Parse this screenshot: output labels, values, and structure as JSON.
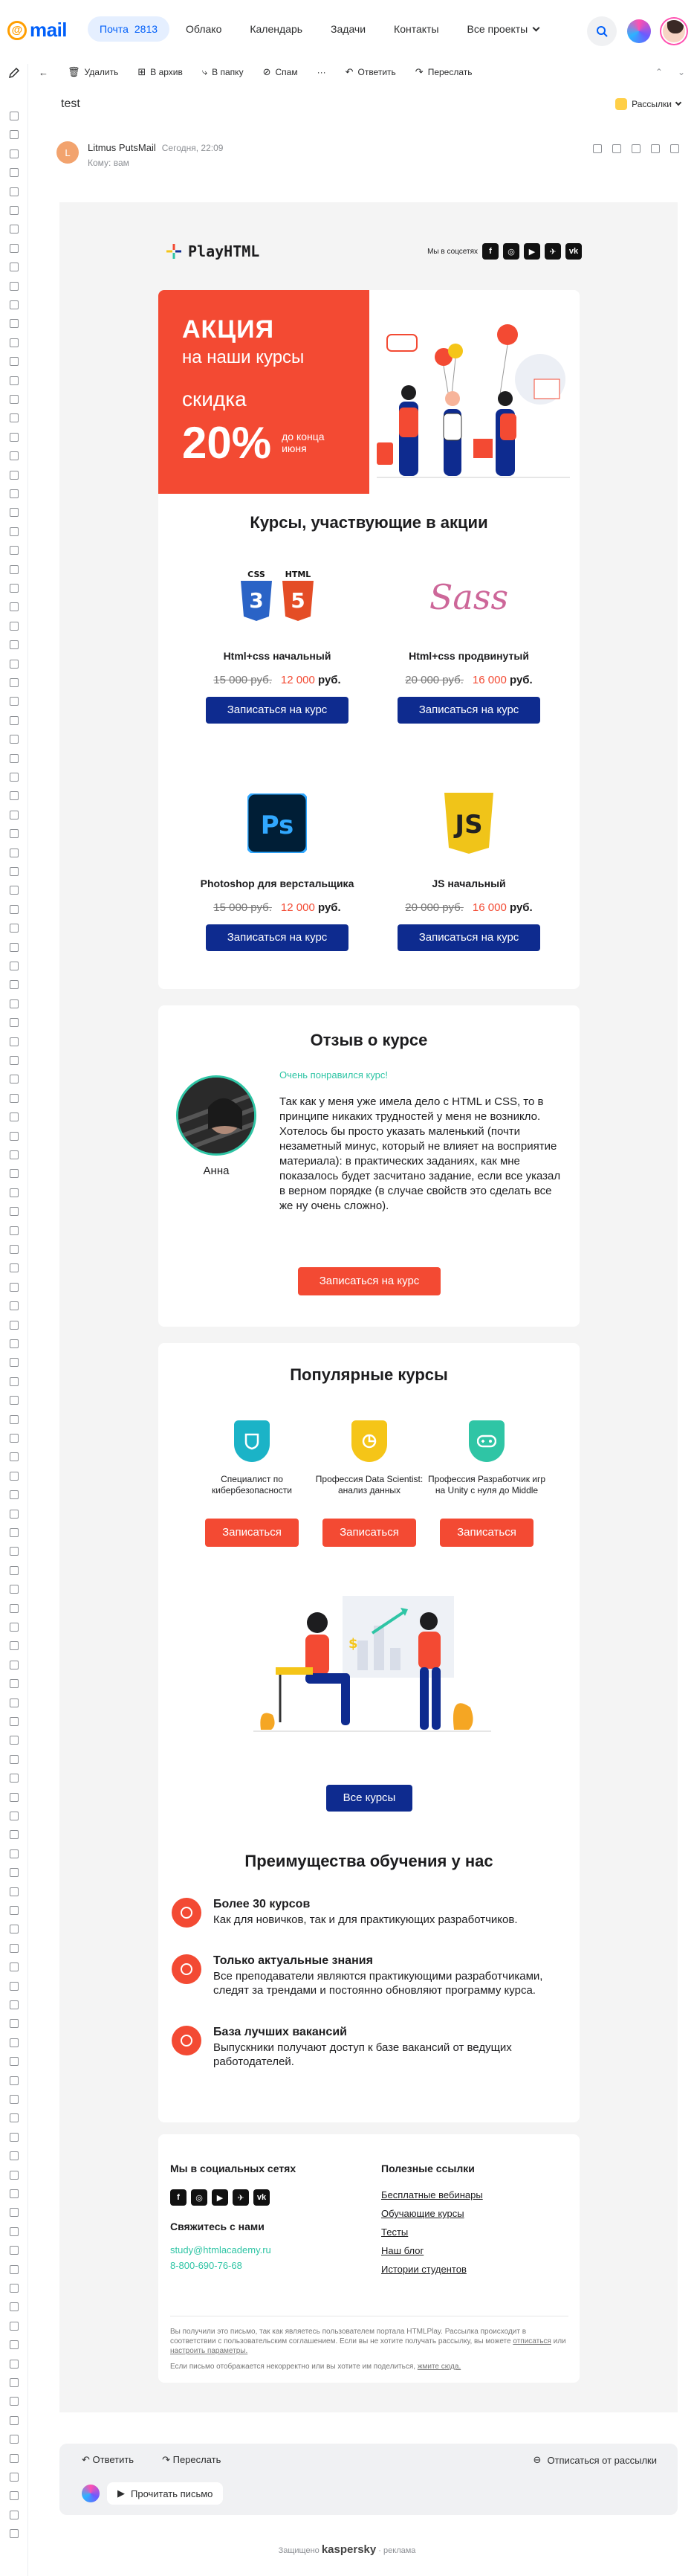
{
  "topbar": {
    "logo_text": "mail",
    "nav": [
      {
        "label": "Почта",
        "count": "2813"
      },
      {
        "label": "Облако"
      },
      {
        "label": "Календарь"
      },
      {
        "label": "Задачи"
      },
      {
        "label": "Контакты"
      },
      {
        "label": "Все проекты"
      }
    ]
  },
  "toolbar": {
    "delete": "Удалить",
    "archive": "В архив",
    "to_folder": "В папку",
    "spam": "Спам",
    "more": "···",
    "reply": "Ответить",
    "forward": "Переслать"
  },
  "message": {
    "subject": "test",
    "category": "Рассылки",
    "sender_initial": "L",
    "sender_name": "Litmus PutsMail",
    "date": "Сегодня, 22:09",
    "to": "Кому: вам"
  },
  "email": {
    "brand": "PlayHTML",
    "social_label": "Мы в соцсетях",
    "social_icons": [
      "f",
      "◎",
      "▶",
      "✈",
      "vk"
    ],
    "promo": {
      "line1": "АКЦИЯ",
      "line2": "на наши курсы",
      "line3": "скидка",
      "percent": "20%",
      "until": "до конца июня"
    },
    "courses_title": "Курсы, участвующие в акции",
    "courses": [
      {
        "name": "Html+css начальный",
        "old": "15 000 руб.",
        "new": "12 000",
        "rub": "руб.",
        "button": "Записаться на курс"
      },
      {
        "name": "Html+css продвинутый",
        "old": "20 000 руб.",
        "new": "16 000",
        "rub": "руб.",
        "button": "Записаться на курс"
      },
      {
        "name": "Photoshop для верстальщика",
        "old": "15 000 руб.",
        "new": "12 000",
        "rub": "руб.",
        "button": "Записаться на курс"
      },
      {
        "name": "JS начальный",
        "old": "20 000 руб.",
        "new": "16 000",
        "rub": "руб.",
        "button": "Записаться на курс"
      }
    ],
    "course_icons": [
      "CSS",
      "HTML",
      "Sass",
      "Ps",
      "JS"
    ],
    "review": {
      "title": "Отзыв о курсе",
      "headline": "Очень понравился курс!",
      "text": "Так как у меня уже имела дело с HTML и CSS, то в принципе никаких трудностей у меня не возникло. Хотелось бы просто указать маленький (почти незаметный минус, который не влияет на восприятие материала): в практических заданиях, как мне показалось будет засчитано задание, если все указал в верном порядке (в случае свойств это сделать все же ну очень сложно).",
      "name": "Анна",
      "button": "Записаться на курс"
    },
    "popular": {
      "title": "Популярные курсы",
      "items": [
        {
          "title": "Специалист по кибербезопасности",
          "button": "Записаться",
          "color": "#1bb3c7"
        },
        {
          "title": "Профессия Data Scientist: анализ данных",
          "button": "Записаться",
          "color": "#f5c518"
        },
        {
          "title": "Профессия Разработчик игр на Unity с нуля до Middle",
          "button": "Записаться",
          "color": "#2fc5a5"
        }
      ],
      "all_button": "Все курсы"
    },
    "advantages": {
      "title": "Преимущества обучения у нас",
      "items": [
        {
          "title": "Более 30 курсов",
          "text": "Как для новичков, так и для практикующих разработчиков."
        },
        {
          "title": "Только актуальные знания",
          "text": "Все преподаватели являются практикующими разработчиками, следят за трендами и постоянно обновляют программу курса."
        },
        {
          "title": "База лучших вакансий",
          "text": "Выпускники получают доступ к базе вакансий от ведущих работодателей."
        }
      ]
    },
    "footer": {
      "social_title": "Мы в социальных сетях",
      "contact_title": "Свяжитесь с нами",
      "email": "study@htmlacademy.ru",
      "phone": "8-800-690-76-68",
      "links_title": "Полезные ссылки",
      "links": [
        "Бесплатные вебинары",
        "Обучающие курсы",
        "Тесты",
        "Наш блог",
        "Истории студентов"
      ],
      "disclaimer1": "Вы получили это письмо, так как являетесь пользователем портала HTMLPlay. Рассылка происходит в соответствии с пользовательским соглашением. Если вы не хотите получать рассылку, вы можете",
      "unsub_link": "отписаться",
      "or": "или",
      "settings_link": "настроить параметры.",
      "disclaimer2": "Если письмо отображается некорректно или вы хотите им поделиться,",
      "view_link": "жмите сюда."
    }
  },
  "replybar": {
    "reply": "Ответить",
    "forward": "Переслать",
    "unsubscribe": "Отписаться от рассылки",
    "read": "Прочитать письмо"
  },
  "protected": {
    "prefix": "Защищено",
    "brand": "kaspersky",
    "suffix": "реклама"
  },
  "colors": {
    "accent_red": "#f34a33",
    "brand_blue": "#0e2b8f",
    "teal": "#2fc5a5",
    "mail_blue": "#005ff9"
  }
}
